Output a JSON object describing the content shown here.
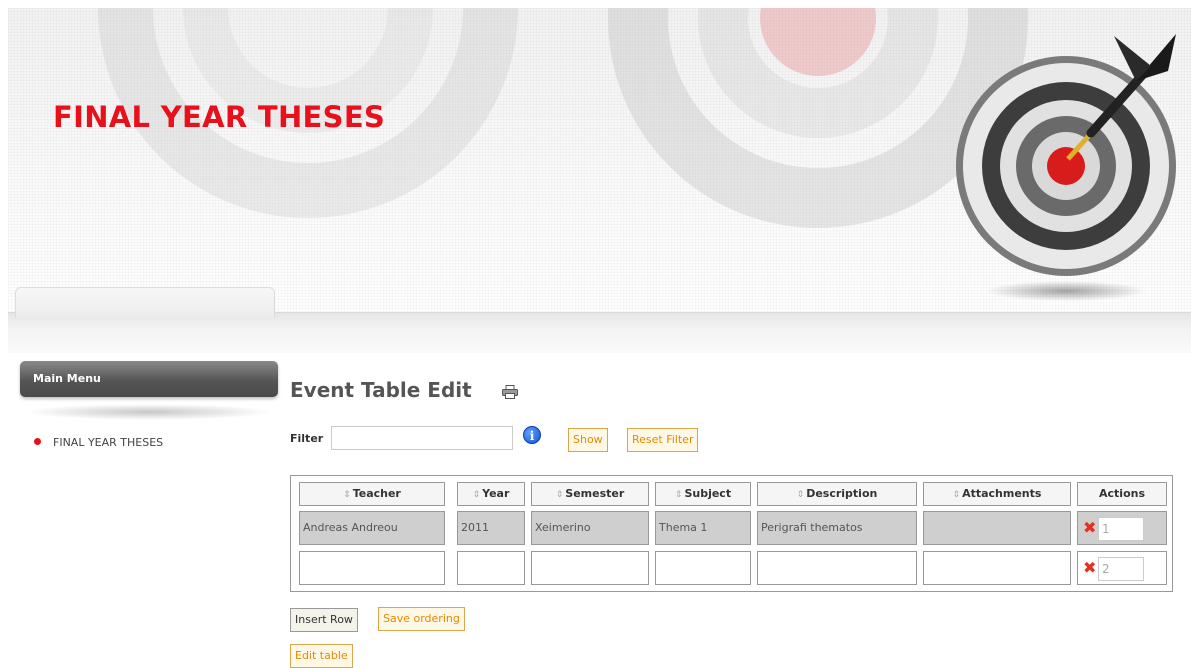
{
  "header": {
    "title": "FINAL YEAR THESES"
  },
  "sidebar": {
    "menu_title": "Main Menu",
    "items": [
      {
        "label": "FINAL YEAR THESES"
      }
    ]
  },
  "main": {
    "title": "Event Table Edit",
    "filter": {
      "label": "Filter",
      "value": "",
      "placeholder": ""
    },
    "show_label": "Show",
    "reset_label": "Reset Filter",
    "table": {
      "columns": [
        "Teacher",
        "Year",
        "Semester",
        "Subject",
        "Description",
        "Attachments",
        "Actions"
      ],
      "rows": [
        {
          "teacher": "Andreas Andreou",
          "year": "2011",
          "semester": "Xeimerino",
          "subject": "Thema 1",
          "description": "Perigrafi thematos",
          "attachments": "",
          "order": "1"
        },
        {
          "teacher": "",
          "year": "",
          "semester": "",
          "subject": "",
          "description": "",
          "attachments": "",
          "order": "2"
        }
      ]
    },
    "insert_row_label": "Insert Row",
    "save_ordering_label": "Save ordering",
    "edit_table_label": "Edit table"
  },
  "colors": {
    "accent_red": "#e8101a",
    "button_orange": "#e68a00"
  },
  "icons": [
    "print-icon",
    "info-icon",
    "delete-icon",
    "target-dart-icon"
  ]
}
